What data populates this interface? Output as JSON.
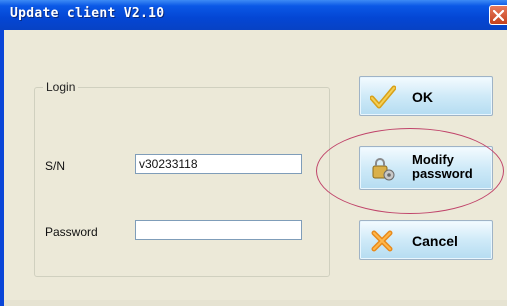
{
  "window": {
    "title": "Update client V2.10"
  },
  "login": {
    "legend": "Login",
    "sn_label": "S/N",
    "sn_value": "v30233118",
    "password_label": "Password",
    "password_value": ""
  },
  "buttons": {
    "ok": "OK",
    "modify_line1": "Modify",
    "modify_line2": "password",
    "cancel": "Cancel"
  },
  "icons": {
    "ok": "checkmark-icon",
    "modify": "lock-gear-icon",
    "cancel": "x-icon",
    "close": "close-icon"
  },
  "colors": {
    "accent": "#0a46d8",
    "highlight": "#c0446a"
  }
}
